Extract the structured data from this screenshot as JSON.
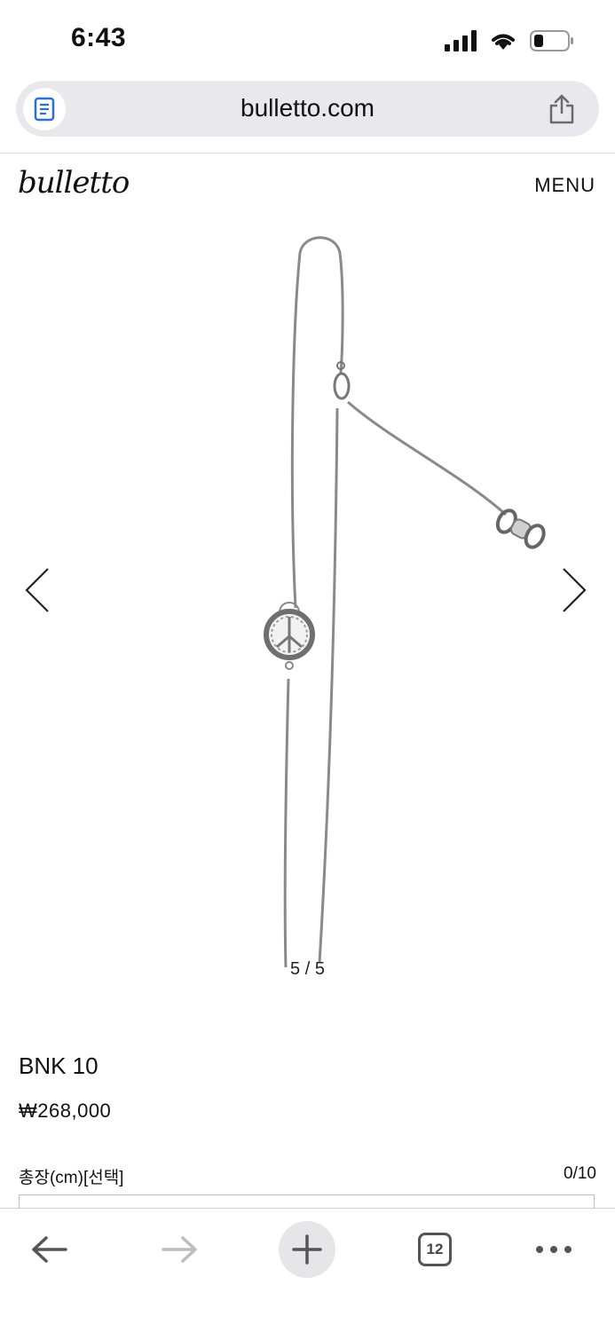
{
  "status_bar": {
    "time": "6:43"
  },
  "browser": {
    "url": "bulletto.com",
    "tabs_count": "12"
  },
  "site": {
    "logo_text": "bulletto",
    "menu_label": "MENU"
  },
  "gallery": {
    "counter": "5 / 5"
  },
  "product": {
    "name": "BNK 10",
    "price": "₩268,000",
    "option_label": "총장(cm)[선택]",
    "option_count": "0/10"
  },
  "icons": {
    "reader": "reader-icon",
    "share": "share-icon",
    "prev": "chevron-left-icon",
    "next": "chevron-right-icon",
    "back": "arrow-left-icon",
    "forward": "arrow-right-icon",
    "new_tab": "plus-icon",
    "more": "more-icon"
  }
}
